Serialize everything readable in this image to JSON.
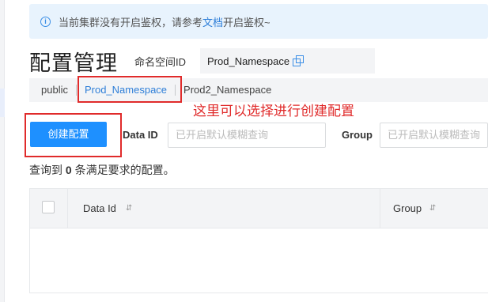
{
  "notice": {
    "prefix": "当前集群没有开启鉴权，请参考",
    "link": "文档",
    "suffix": "开启鉴权~"
  },
  "page": {
    "title": "配置管理",
    "namespace_label": "命名空间ID",
    "namespace_value": "Prod_Namespace"
  },
  "namespaces": [
    {
      "label": "public"
    },
    {
      "label": "Prod_Namespace"
    },
    {
      "label": "Prod2_Namespace"
    }
  ],
  "annotation": "这里可以选择进行创建配置",
  "toolbar": {
    "create_label": "创建配置",
    "data_id_label": "Data ID",
    "data_id_placeholder": "已开启默认模糊查询",
    "group_label": "Group",
    "group_placeholder": "已开启默认模糊查询"
  },
  "result": {
    "prefix": "查询到",
    "count": "0",
    "suffix": "条满足要求的配置。"
  },
  "table": {
    "columns": [
      "Data Id",
      "Group"
    ]
  },
  "colors": {
    "accent": "#1e90ff",
    "annotation_red": "#e02b2b",
    "notice_bg": "#e8f3fd"
  }
}
